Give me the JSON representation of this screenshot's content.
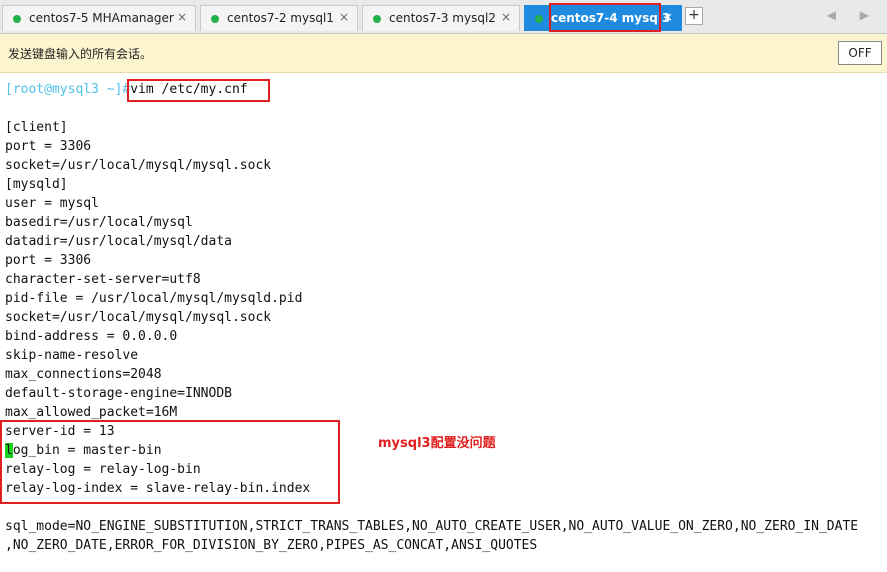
{
  "tabs": [
    {
      "label": "centos7-5 MHAmanager",
      "close": "×"
    },
    {
      "label": "centos7-2 mysql1",
      "close": "×"
    },
    {
      "label": "centos7-3 mysql2",
      "close": "×"
    },
    {
      "label": "centos7-4 mysql3",
      "close": "×"
    }
  ],
  "add_tab": "+",
  "nav_arrows": "◀ ▶",
  "notice": {
    "message": "发送键盘输入的所有会话。",
    "off_button": "OFF"
  },
  "terminal": {
    "prompt": "[root@mysql3 ~]#",
    "command": "vim /etc/my.cnf",
    "lines": [
      "[client]",
      "port = 3306",
      "socket=/usr/local/mysql/mysql.sock",
      "[mysqld]",
      "user = mysql",
      "basedir=/usr/local/mysql",
      "datadir=/usr/local/mysql/data",
      "port = 3306",
      "character-set-server=utf8",
      "pid-file = /usr/local/mysql/mysqld.pid",
      "socket=/usr/local/mysql/mysql.sock",
      "bind-address = 0.0.0.0",
      "skip-name-resolve",
      "max_connections=2048",
      "default-storage-engine=INNODB",
      "max_allowed_packet=16M",
      "server-id = 13",
      "og_bin = master-bin",
      "relay-log = relay-log-bin",
      "relay-log-index = slave-relay-bin.index"
    ],
    "cursor_char": "l",
    "sql_mode_1": "sql_mode=NO_ENGINE_SUBSTITUTION,STRICT_TRANS_TABLES,NO_AUTO_CREATE_USER,NO_AUTO_VALUE_ON_ZERO,NO_ZERO_IN_DATE",
    "sql_mode_2": ",NO_ZERO_DATE,ERROR_FOR_DIVISION_BY_ZERO,PIPES_AS_CONCAT,ANSI_QUOTES"
  },
  "annotation": "mysql3配置没问题",
  "colors": {
    "accent": "#1e8be0",
    "highlight": "#e02020",
    "status_dot": "#22b14c",
    "cursor": "#1bd11b"
  }
}
